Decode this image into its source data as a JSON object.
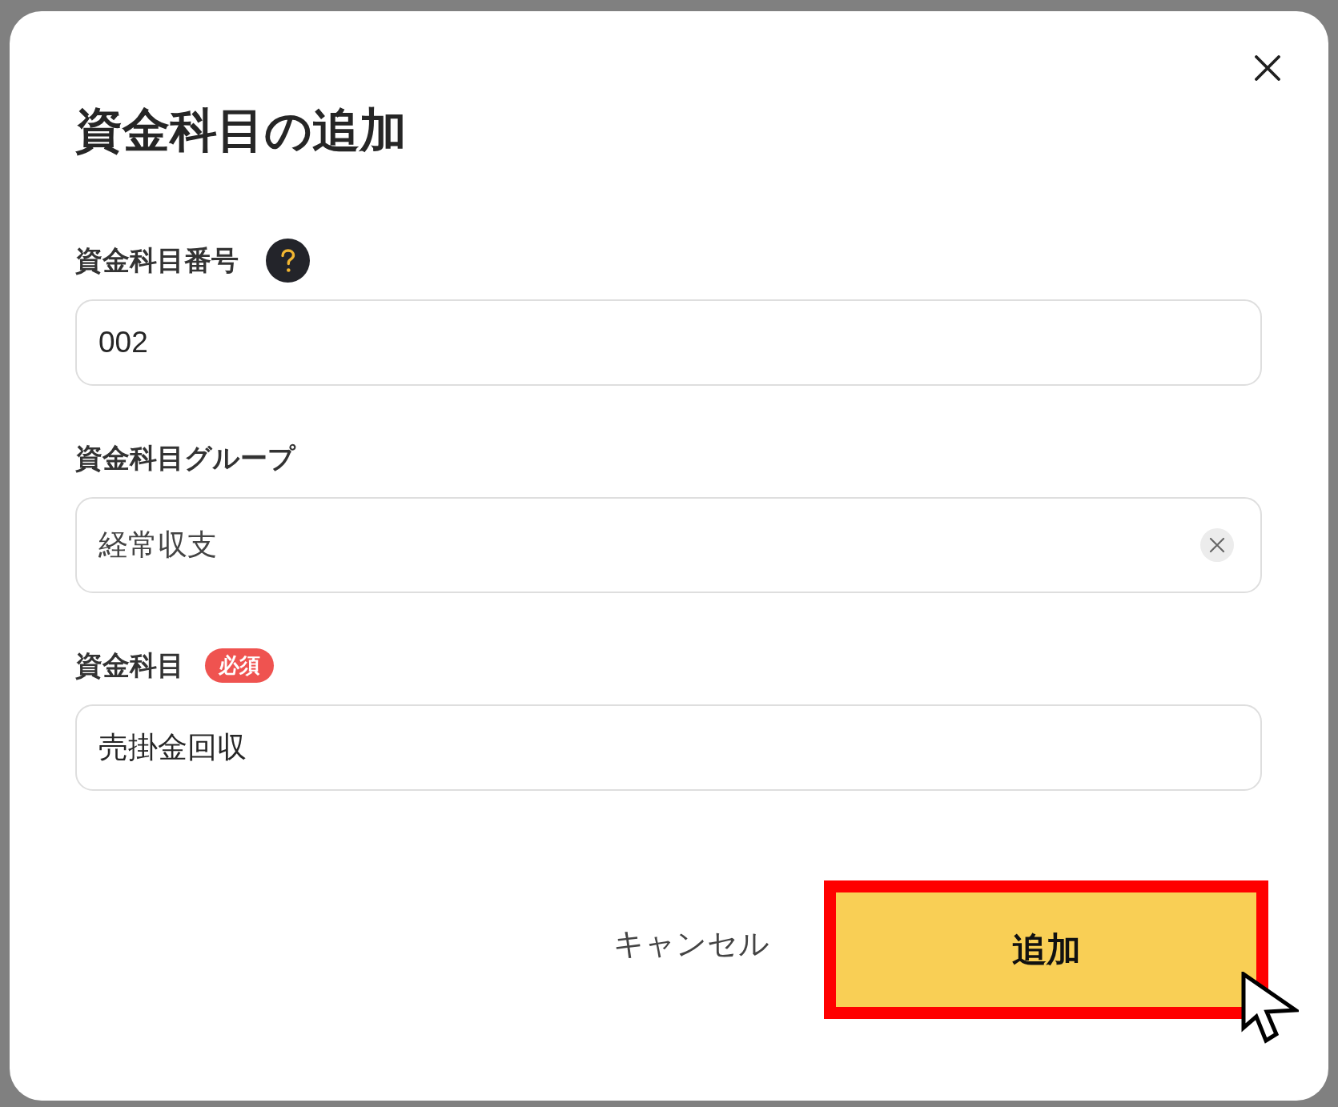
{
  "dialog": {
    "title": "資金科目の追加"
  },
  "fields": [
    {
      "label": "資金科目番号",
      "kind": "text",
      "help": true,
      "value": "002"
    },
    {
      "label": "資金科目グループ",
      "kind": "select",
      "help": false,
      "value": "経常収支"
    },
    {
      "label": "資金科目",
      "kind": "text",
      "help": false,
      "badge": "必須",
      "value": "売掛金回収"
    }
  ],
  "buttons": [
    {
      "label": "キャンセル",
      "kind": "secondary",
      "highlighted": false
    },
    {
      "label": "追加",
      "kind": "primary",
      "highlighted": true
    }
  ]
}
